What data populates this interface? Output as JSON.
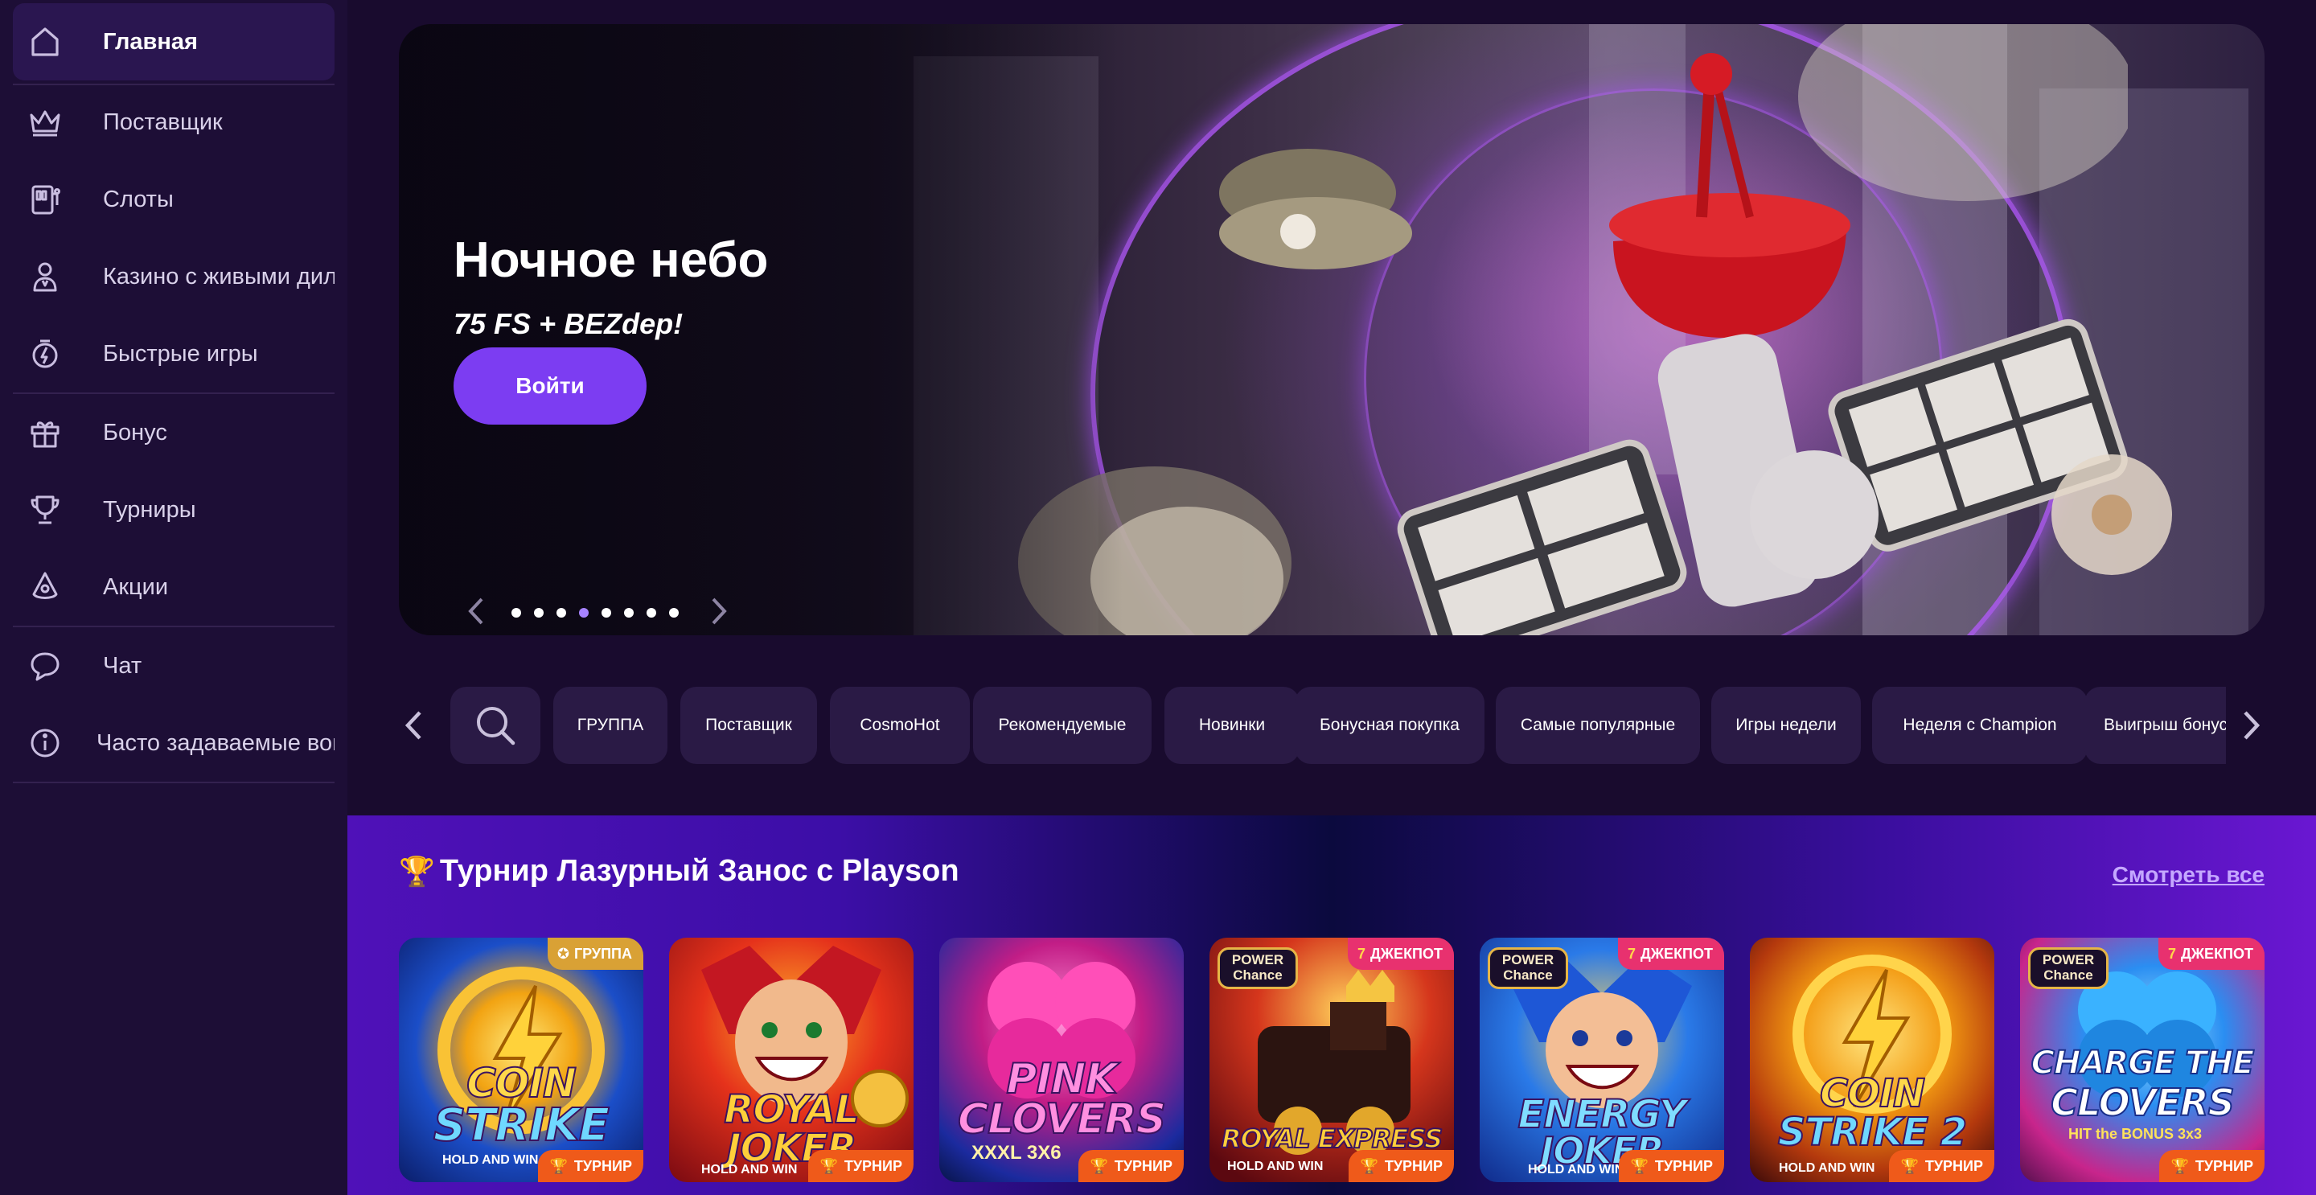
{
  "sidebar": {
    "items": [
      {
        "label": "Главная",
        "icon": "home-icon"
      },
      {
        "label": "Поставщик",
        "icon": "crown-icon"
      },
      {
        "label": "Слоты",
        "icon": "slot-machine-icon"
      },
      {
        "label": "Казино с живыми дилерами",
        "icon": "dealer-icon"
      },
      {
        "label": "Быстрые игры",
        "icon": "fast-games-icon"
      },
      {
        "label": "Бонус",
        "icon": "gift-icon"
      },
      {
        "label": "Турниры",
        "icon": "trophy-icon"
      },
      {
        "label": "Акции",
        "icon": "promo-icon"
      },
      {
        "label": "Чат",
        "icon": "chat-icon"
      },
      {
        "label": "Часто задаваемые вопросы",
        "icon": "info-icon"
      }
    ]
  },
  "banner": {
    "title": "Ночное небо",
    "subtitle": "75 FS + BEZdep!",
    "button_label": "Войти",
    "slide_count": 8,
    "active_slide": 4
  },
  "categories": {
    "chips": [
      "ГРУППА",
      "Поставщик",
      "CosmoHot",
      "Рекомендуемые",
      "Новинки",
      "Бонусная покупка",
      "Самые популярные",
      "Игры недели",
      "Неделя с Champion",
      "Выигрыш бонусов"
    ]
  },
  "tournament": {
    "emoji": "🏆",
    "title": "Турнир Лазурный Занос с Playson",
    "see_all": "Смотреть все",
    "games": [
      {
        "title_1": "COIN",
        "title_2": "STRIKE",
        "sub": "HOLD AND WIN",
        "top_badge": "ГРУППА",
        "bottom_badge": "ТУРНИР"
      },
      {
        "title_1": "ROYAL",
        "title_2": "JOKER",
        "sub": "HOLD AND WIN",
        "top_badge": "",
        "bottom_badge": "ТУРНИР"
      },
      {
        "title_1": "PINK",
        "title_2": "CLOVERS",
        "sub": "XXXL 3X6",
        "top_badge": "",
        "bottom_badge": "ТУРНИР"
      },
      {
        "title_1": "ROYAL EXPRESS",
        "title_2": "",
        "sub": "HOLD AND WIN",
        "top_badge": "ДЖЕКПОТ",
        "bottom_badge": "ТУРНИР",
        "power_chance": "POWER Chance"
      },
      {
        "title_1": "ENERGY",
        "title_2": "JOKER",
        "sub": "HOLD AND WIN",
        "top_badge": "ДЖЕКПОТ",
        "bottom_badge": "ТУРНИР",
        "power_chance": "POWER Chance"
      },
      {
        "title_1": "COIN",
        "title_2": "STRIKE 2",
        "sub": "HOLD AND WIN",
        "top_badge": "",
        "bottom_badge": "ТУРНИР"
      },
      {
        "title_1": "CHARGE THE",
        "title_2": "CLOVERS",
        "sub": "HIT the BONUS 3x3",
        "top_badge": "ДЖЕКПОТ",
        "bottom_badge": "ТУРНИР",
        "power_chance": "POWER Chance"
      }
    ]
  },
  "colors": {
    "accent": "#7c3df2",
    "sidebar_bg": "#1d0e36",
    "page_bg": "#190b2e",
    "chip_bg": "#2a1a45",
    "badge_orange": "#ef5a1a",
    "badge_pink": "#e8316f",
    "badge_gold": "#d9a135"
  }
}
